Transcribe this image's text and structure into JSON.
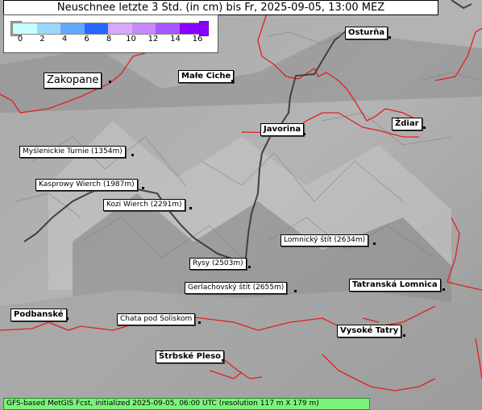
{
  "title": "Neuschnee letzte 3 Std. (in cm) bis Fr, 2025-09-05, 13:00 MEZ",
  "legend": {
    "ticks": [
      "0",
      "2",
      "4",
      "6",
      "8",
      "10",
      "12",
      "14",
      "16"
    ],
    "colors": [
      "#c8ffff",
      "#9ad8ff",
      "#62a8ff",
      "#2468ff",
      "#d8a8ff",
      "#c888ff",
      "#a858ff",
      "#8800ff"
    ]
  },
  "places": {
    "zakopane": "Zakopane",
    "male_ciche": "Małe Ciche",
    "osturna": "Osturňa",
    "javorina": "Javorina",
    "zdiar": "Ždiar",
    "mysl": "Myślenickie Turnie (1354m)",
    "kasprowy": "Kasprowy Wierch (1987m)",
    "kozi": "Kozi Wierch (2291m)",
    "lomnicky": "Lomnický štít (2634m)",
    "rysy": "Rysy (2503m)",
    "gerlach": "Gerlachovský štít (2655m)",
    "tatr_lomnica": "Tatranská Lomnica",
    "podbanske": "Podbanské",
    "chata": "Chata pod Soliskom",
    "vysoke": "Vysoké Tatry",
    "strbske": "Štrbské Pleso"
  },
  "footer": "GFS-based MetGIS Fcst, initialized 2025-09-05, 06:00 UTC  (resolution 117 m X 179 m)"
}
